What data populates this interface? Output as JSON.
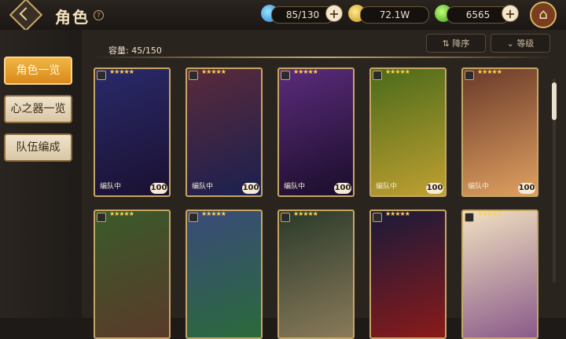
{
  "header": {
    "title": "角色",
    "help": "?",
    "resources": [
      {
        "name": "stamina",
        "value": "85/130",
        "icon": "blue-drop-icon",
        "color": "#3fb6ff"
      },
      {
        "name": "gold",
        "value": "72.1W",
        "icon": "gold-coin-icon",
        "color": "#f1c232"
      },
      {
        "name": "gem",
        "value": "6565",
        "icon": "green-leaf-gem-icon",
        "color": "#59d62a"
      }
    ],
    "plus": "+",
    "home_icon": "home-icon"
  },
  "sidebar": {
    "items": [
      {
        "label": "角色一览",
        "active": true
      },
      {
        "label": "心之器一览",
        "active": false
      },
      {
        "label": "队伍编成",
        "active": false
      }
    ]
  },
  "main": {
    "capacity": "容量: 45/150",
    "sort_label": "降序",
    "sort_icon": "sort-icon",
    "level_label": "等级",
    "level_icon": "chevron-down-icon",
    "cards": [
      {
        "stars": "★★★★★",
        "team": "编队中",
        "level": "100",
        "bg1": "#2a2a6a",
        "bg2": "#1a1030"
      },
      {
        "stars": "★★★★★",
        "team": "编队中",
        "level": "100",
        "bg1": "#5a2a3a",
        "bg2": "#1a2050"
      },
      {
        "stars": "★★★★★",
        "team": "编队中",
        "level": "100",
        "bg1": "#5a2b7a",
        "bg2": "#1a0d2a"
      },
      {
        "stars": "★★★★★",
        "team": "编队中",
        "level": "100",
        "bg1": "#4a6a1a",
        "bg2": "#c0a030"
      },
      {
        "stars": "★★★★★",
        "team": "编队中",
        "level": "100",
        "bg1": "#6a3a2a",
        "bg2": "#e0a060"
      },
      {
        "stars": "★★★★★",
        "team": "",
        "level": "",
        "bg1": "#3a5a2a",
        "bg2": "#5a3a2a"
      },
      {
        "stars": "★★★★★",
        "team": "",
        "level": "",
        "bg1": "#3a4a7a",
        "bg2": "#2a6a3a"
      },
      {
        "stars": "★★★★★",
        "team": "",
        "level": "",
        "bg1": "#2a3a2a",
        "bg2": "#8a7a5a"
      },
      {
        "stars": "★★★★★",
        "team": "",
        "level": "",
        "bg1": "#1a1a3a",
        "bg2": "#8a1a1a"
      },
      {
        "stars": "★★★★★",
        "team": "",
        "level": "",
        "bg1": "#f0e0c0",
        "bg2": "#8a5a8a"
      }
    ]
  }
}
